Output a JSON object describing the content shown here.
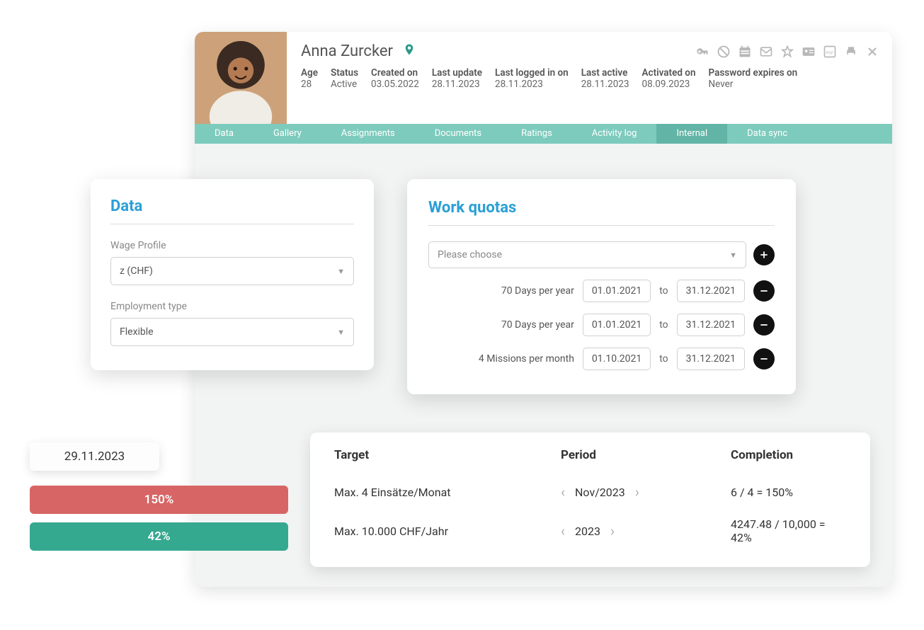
{
  "profile": {
    "name": "Anna Zurcker",
    "meta": [
      {
        "label": "Age",
        "value": "28"
      },
      {
        "label": "Status",
        "value": "Active"
      },
      {
        "label": "Created on",
        "value": "03.05.2022"
      },
      {
        "label": "Last update",
        "value": "28.11.2023"
      },
      {
        "label": "Last logged in on",
        "value": "28.11.2023"
      },
      {
        "label": "Last active",
        "value": "28.11.2023"
      },
      {
        "label": "Activated on",
        "value": "08.09.2023"
      },
      {
        "label": "Password expires on",
        "value": "Never"
      }
    ]
  },
  "tabs": [
    "Data",
    "Gallery",
    "Assignments",
    "Documents",
    "Ratings",
    "Activity log",
    "Internal",
    "Data sync"
  ],
  "active_tab": "Internal",
  "data_card": {
    "title": "Data",
    "wage_label": "Wage Profile",
    "wage_value": "z (CHF)",
    "emp_label": "Employment type",
    "emp_value": "Flexible"
  },
  "quotas": {
    "title": "Work quotas",
    "placeholder": "Please choose",
    "to": "to",
    "rows": [
      {
        "label": "70 Days per year",
        "from": "01.01.2021",
        "to": "31.12.2021"
      },
      {
        "label": "70 Days per year",
        "from": "01.01.2021",
        "to": "31.12.2021"
      },
      {
        "label": "4 Missions per month",
        "from": "01.10.2021",
        "to": "31.12.2021"
      }
    ]
  },
  "targets": {
    "head": {
      "target": "Target",
      "period": "Period",
      "completion": "Completion"
    },
    "rows": [
      {
        "target": "Max. 4 Einsätze/Monat",
        "period": "Nov/2023",
        "completion": "6 / 4 = 150%"
      },
      {
        "target": "Max. 10.000 CHF/Jahr",
        "period": "2023",
        "completion": "4247.48 / 10,000 = 42%"
      }
    ]
  },
  "overlay": {
    "date": "29.11.2023",
    "red": "150%",
    "green": "42%"
  }
}
